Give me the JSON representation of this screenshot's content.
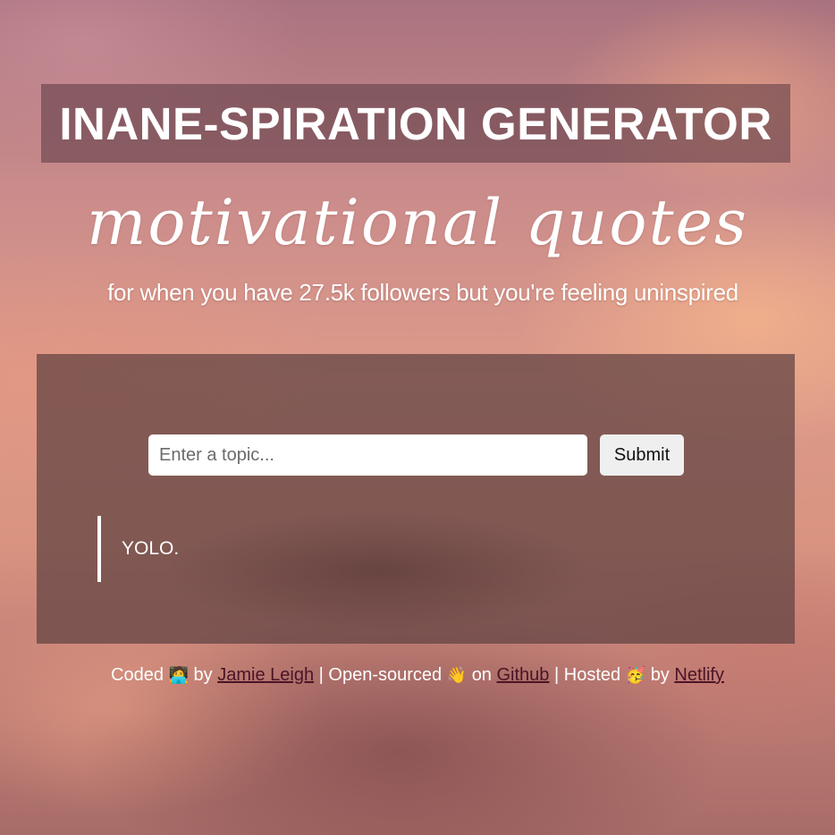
{
  "header": {
    "title": "INANE-SPIRATION GENERATOR",
    "script_title": "motivational quotes",
    "subtitle": "for when you have 27.5k followers but you're feeling uninspired"
  },
  "form": {
    "topic_placeholder": "Enter a topic...",
    "topic_value": "",
    "submit_label": "Submit"
  },
  "quote": {
    "text": "YOLO."
  },
  "footer": {
    "coded_text": "Coded",
    "coded_emoji": "🧑‍💻",
    "by_1": "by",
    "author_link": "Jamie Leigh",
    "sep_1": "|",
    "open_sourced_text": "Open-sourced",
    "open_sourced_emoji": "👋",
    "on_text": "on",
    "github_link": "Github",
    "sep_2": "|",
    "hosted_text": "Hosted",
    "hosted_emoji": "🥳",
    "by_2": "by",
    "netlify_link": "Netlify"
  },
  "colors": {
    "title_box": "#5f3c46",
    "panel": "#5f4141",
    "link": "#4a1426"
  }
}
